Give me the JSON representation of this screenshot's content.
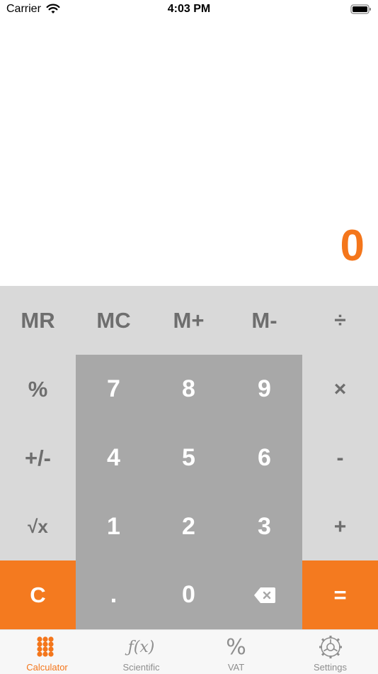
{
  "status_bar": {
    "carrier": "Carrier",
    "time": "4:03 PM"
  },
  "display": {
    "value": "0",
    "color": "#f4761b"
  },
  "keys": {
    "mr": "MR",
    "mc": "MC",
    "mplus": "M+",
    "mminus": "M-",
    "divide": "÷",
    "percent": "%",
    "seven": "7",
    "eight": "8",
    "nine": "9",
    "multiply": "×",
    "plusminus": "+/-",
    "four": "4",
    "five": "5",
    "six": "6",
    "subtract": "-",
    "sqrt": "√x",
    "one": "1",
    "two": "2",
    "three": "3",
    "add": "+",
    "clear": "C",
    "dot": ".",
    "zero": "0",
    "equals": "="
  },
  "tabs": [
    {
      "label": "Calculator",
      "icon": "keypad-grid-icon",
      "active": true
    },
    {
      "label": "Scientific",
      "icon": "function-icon",
      "active": false
    },
    {
      "label": "VAT",
      "icon": "percent-icon",
      "active": false
    },
    {
      "label": "Settings",
      "icon": "gear-icon",
      "active": false
    }
  ],
  "colors": {
    "accent": "#f4761b",
    "keypad_bg": "#d9d9d9",
    "digit_panel_bg": "#a8a8a8",
    "func_text": "#6e6e6e"
  }
}
